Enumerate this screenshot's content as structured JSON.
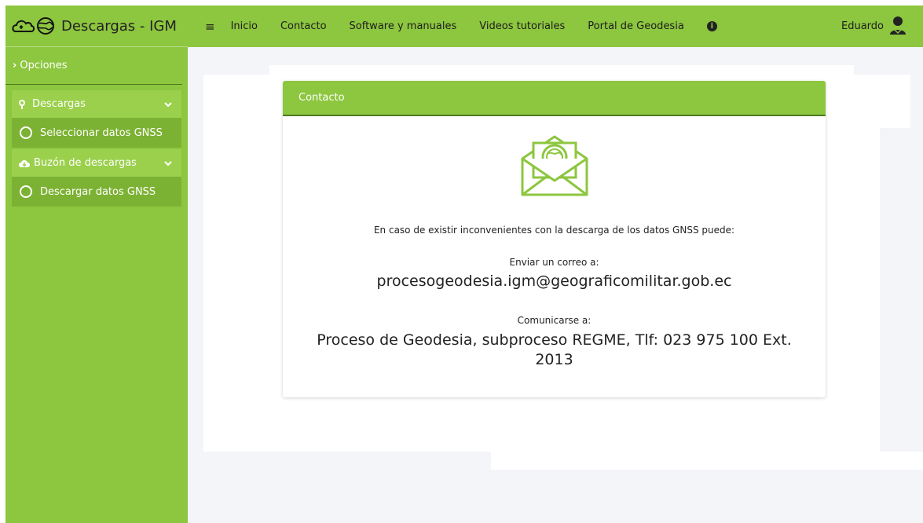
{
  "brand": {
    "title": "Descargas - IGM"
  },
  "sidebar": {
    "opciones": "Opciones",
    "groups": [
      {
        "label": "Descargas",
        "items": [
          "Seleccionar datos GNSS"
        ]
      },
      {
        "label": "Buzón de descargas",
        "items": [
          "Descargar datos GNSS"
        ]
      }
    ]
  },
  "topbar": {
    "links": [
      "Inicio",
      "Contacto",
      "Software y manuales",
      "Videos tutoriales",
      "Portal de Geodesia"
    ],
    "user": "Eduardo"
  },
  "card": {
    "title": "Contacto",
    "intro": "En caso de existir inconvenientes con la descarga de los datos GNSS puede:",
    "email_label": "Enviar un correo a:",
    "email": "procesogeodesia.igm@geograficomilitar.gob.ec",
    "phone_label": "Comunicarse a:",
    "phone": "Proceso de Geodesia, subproceso REGME, Tlf: 023 975 100 Ext. 2013"
  },
  "colors": {
    "accent": "#8dc63f",
    "accent_dark": "#7cb233",
    "divider": "#4f7a1f"
  },
  "icons": [
    "cloud-globe-logo-icon",
    "chevron-right-icon",
    "pin-icon",
    "chevron-down-icon",
    "circle-icon",
    "cloud-download-icon",
    "hamburger-icon",
    "info-icon",
    "user-avatar-icon",
    "envelope-globe-icon"
  ]
}
